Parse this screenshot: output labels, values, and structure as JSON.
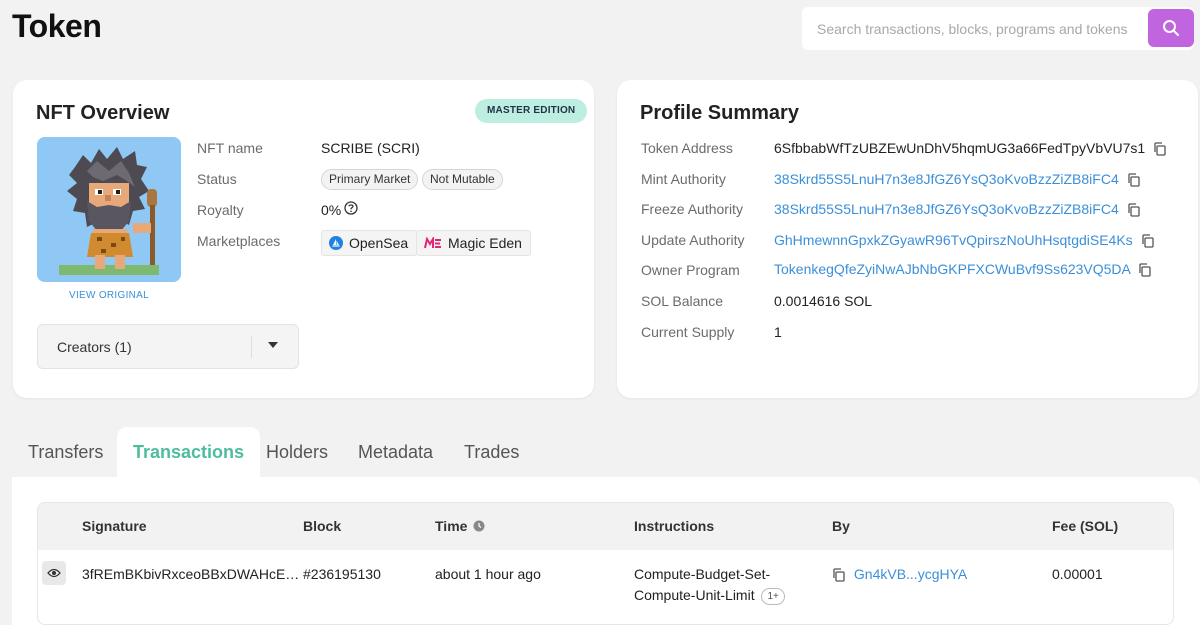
{
  "page": {
    "title": "Token"
  },
  "search": {
    "placeholder": "Search transactions, blocks, programs and tokens"
  },
  "nft_overview": {
    "title": "NFT Overview",
    "edition_badge": "MASTER EDITION",
    "view_original": "VIEW ORIGINAL",
    "creators_label": "Creators (1)",
    "rows": {
      "name_label": "NFT name",
      "name_value": "SCRIBE (SCRI)",
      "status_label": "Status",
      "status_chips": [
        "Primary Market",
        "Not Mutable"
      ],
      "royalty_label": "Royalty",
      "royalty_value": "0%",
      "marketplaces_label": "Marketplaces",
      "marketplaces": [
        "OpenSea",
        "Magic Eden"
      ]
    }
  },
  "profile_summary": {
    "title": "Profile Summary",
    "rows": [
      {
        "label": "Token Address",
        "value": "6SfbbabWfTzUBZEwUnDhV5hqmUG3a66FedTpyVbVU7s1"
      },
      {
        "label": "Mint Authority",
        "value": "38Skrd55S5LnuH7n3e8JfGZ6YsQ3oKvoBzzZiZB8iFC4"
      },
      {
        "label": "Freeze Authority",
        "value": "38Skrd55S5LnuH7n3e8JfGZ6YsQ3oKvoBzzZiZB8iFC4"
      },
      {
        "label": "Update Authority",
        "value": "GhHmewnnGpxkZGyawR96TvQpirszNoUhHsqtgdiSE4Ks"
      },
      {
        "label": "Owner Program",
        "value": "TokenkegQfeZyiNwAJbNbGKPFXCWuBvf9Ss623VQ5DA"
      },
      {
        "label": "SOL Balance",
        "value": "0.0014616 SOL"
      },
      {
        "label": "Current Supply",
        "value": "1"
      }
    ]
  },
  "tabs": [
    "Transfers",
    "Transactions",
    "Holders",
    "Metadata",
    "Trades"
  ],
  "active_tab": "Transactions",
  "table": {
    "headers": [
      "Signature",
      "Block",
      "Time",
      "Instructions",
      "By",
      "Fee (SOL)"
    ],
    "rows": [
      {
        "signature": "3fREmBKbivRxceoBBxDWAHcE…",
        "block": "#236195130",
        "time": "about 1 hour ago",
        "instructions_line1": "Compute-Budget-Set-",
        "instructions_line2": "Compute-Unit-Limit",
        "instructions_more": "1+",
        "by": "Gn4kVB...ycgHYA",
        "fee": "0.00001"
      }
    ]
  },
  "colors": {
    "accent_purple": "#c064e0",
    "active_tab_green": "#4dbd9d",
    "link_blue": "#3b8fd9",
    "badge_mint": "#bdeee2"
  }
}
